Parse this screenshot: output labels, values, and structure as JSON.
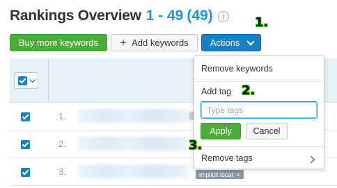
{
  "header": {
    "title": "Rankings Overview",
    "range": "1 - 49",
    "count": "(49)",
    "info_icon": "i"
  },
  "markers": {
    "step1": "1.",
    "step2": "2.",
    "step3": "3."
  },
  "toolbar": {
    "buy_label": "Buy more keywords",
    "add_label": "Add keywords",
    "add_icon": "+",
    "actions_label": "Actions"
  },
  "table": {
    "rows": [
      {
        "rank": "1.",
        "checked": true
      },
      {
        "rank": "2.",
        "checked": true
      },
      {
        "rank": "3.",
        "checked": true
      }
    ],
    "tag_chip": "implicit local",
    "tag_chip_remove": "×"
  },
  "dropdown": {
    "remove_keywords": "Remove keywords",
    "add_tag": "Add tag",
    "tag_placeholder": "Type tags",
    "apply_label": "Apply",
    "cancel_label": "Cancel",
    "remove_tags": "Remove tags"
  },
  "colors": {
    "accent_blue": "#1a7ec3",
    "link_blue": "#1a96d6",
    "green": "#4aad37",
    "header_bg": "#e6f0f7"
  }
}
